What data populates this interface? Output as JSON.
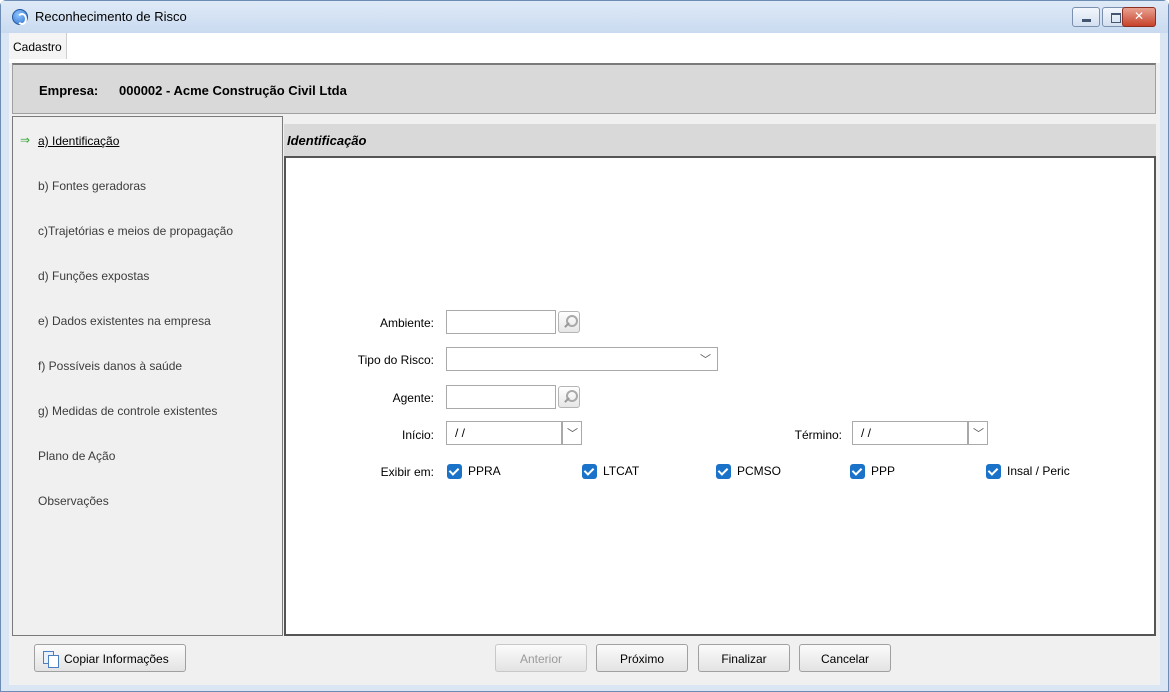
{
  "window": {
    "title": "Reconhecimento de Risco",
    "app_icon": "app-logo-icon"
  },
  "menu": {
    "items": [
      {
        "label": "Cadastro"
      }
    ]
  },
  "company": {
    "label": "Empresa:",
    "value": "000002 - Acme Construção Civil Ltda"
  },
  "sidebar": {
    "active_index": 0,
    "items": [
      {
        "label": "a) Identificação"
      },
      {
        "label": "b) Fontes geradoras"
      },
      {
        "label": "c)Trajetórias e meios de propagação"
      },
      {
        "label": "d) Funções expostas"
      },
      {
        "label": "e) Dados existentes na empresa"
      },
      {
        "label": "f) Possíveis danos à saúde"
      },
      {
        "label": "g) Medidas de controle existentes"
      },
      {
        "label": "Plano de Ação"
      },
      {
        "label": "Observações"
      }
    ]
  },
  "panel": {
    "title": "Identificação"
  },
  "form": {
    "ambiente": {
      "label": "Ambiente:",
      "value": ""
    },
    "tipo_risco": {
      "label": "Tipo do Risco:",
      "value": ""
    },
    "agente": {
      "label": "Agente:",
      "value": ""
    },
    "inicio": {
      "label": "Início:",
      "value": " /  /"
    },
    "termino": {
      "label": "Término:",
      "value": " /  /"
    },
    "exibir_em": {
      "label": "Exibir em:",
      "options": [
        {
          "label": "PPRA",
          "checked": true
        },
        {
          "label": "LTCAT",
          "checked": true
        },
        {
          "label": "PCMSO",
          "checked": true
        },
        {
          "label": "PPP",
          "checked": true
        },
        {
          "label": "Insal / Peric",
          "checked": true
        }
      ]
    }
  },
  "buttons": {
    "copy": "Copiar Informações",
    "previous": "Anterior",
    "next": "Próximo",
    "finish": "Finalizar",
    "cancel": "Cancelar"
  },
  "colors": {
    "checkbox_accent": "#1a73c9",
    "nav_arrow": "#3aa63a"
  }
}
